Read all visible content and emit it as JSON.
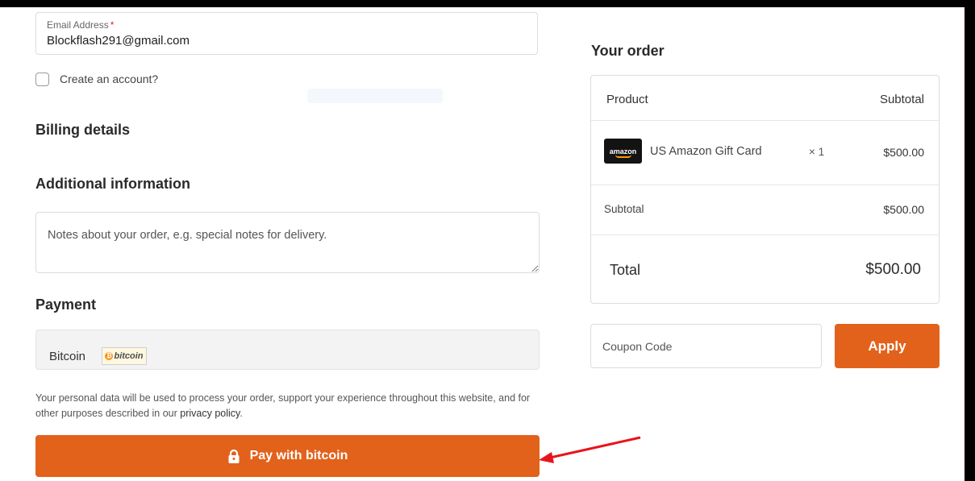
{
  "contact": {
    "email_label": "Email Address",
    "required_mark": "*",
    "email_value": "Blockflash291@gmail.com",
    "create_account_label": "Create an account?"
  },
  "billing": {
    "heading": "Billing details"
  },
  "additional": {
    "heading": "Additional information",
    "notes_placeholder": "Notes about your order, e.g. special notes for delivery."
  },
  "payment": {
    "heading": "Payment",
    "method_name": "Bitcoin",
    "method_logo_text": "bitcoin",
    "privacy_text": "Your personal data will be used to process your order, support your experience throughout this website, and for other purposes described in our ",
    "privacy_link": "privacy policy",
    "privacy_end": ".",
    "pay_button_label": "Pay with bitcoin"
  },
  "order": {
    "heading": "Your order",
    "col_product": "Product",
    "col_subtotal": "Subtotal",
    "items": [
      {
        "logo_text": "amazon",
        "name": "US Amazon Gift Card",
        "qty": "× 1",
        "price": "$500.00"
      }
    ],
    "subtotal_label": "Subtotal",
    "subtotal_value": "$500.00",
    "total_label": "Total",
    "total_value": "$500.00"
  },
  "coupon": {
    "placeholder": "Coupon Code",
    "apply_label": "Apply"
  },
  "colors": {
    "accent": "#e2621b",
    "annotation_arrow": "#e8141b",
    "required": "#e0261b"
  },
  "icons": {
    "pay_button": "lock-icon",
    "annotation": "red-arrow-icon"
  }
}
